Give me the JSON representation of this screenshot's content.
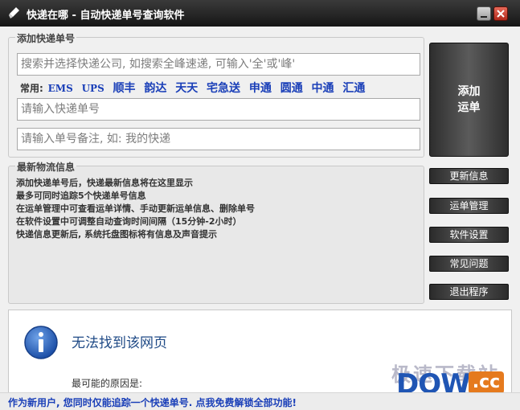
{
  "window": {
    "title": "快递在哪 - 自动快递单号查询软件"
  },
  "add_group": {
    "legend": "添加快递单号",
    "company_search_placeholder": "搜索并选择快递公司, 如搜索全峰速递, 可输入'全'或'峰'",
    "common_label": "常用:",
    "common_couriers": [
      "EMS",
      "UPS",
      "顺丰",
      "韵达",
      "天天",
      "宅急送",
      "申通",
      "圆通",
      "中通",
      "汇通"
    ],
    "tracking_placeholder": "请输入快递单号",
    "remark_placeholder": "请输入单号备注, 如: 我的快递"
  },
  "add_button": {
    "line1": "添加",
    "line2": "运单"
  },
  "info_group": {
    "legend": "最新物流信息",
    "lines": [
      "添加快递单号后，快递最新信息将在这里显示",
      "最多可同时追踪5个快递单号信息",
      "在运单管理中可查看运单详情、手动更新运单信息、删除单号",
      "在软件设置中可调整自动查询时间间隔（15分钟-2小时）",
      "快递信息更新后, 系统托盘图标将有信息及声音提示"
    ]
  },
  "side_buttons": {
    "update": "更新信息",
    "manage": "运单管理",
    "settings": "软件设置",
    "faq": "常见问题",
    "exit": "退出程序"
  },
  "browser_panel": {
    "error_title": "无法找到该网页",
    "reasons_label": "最可能的原因是:"
  },
  "watermark": {
    "top": "极速下载站",
    "down": "DOWN",
    "cc": ".cc"
  },
  "status_bar": {
    "text": "作为新用户, 您同时仅能追踪一个快递单号. 点我免费解锁全部功能!"
  },
  "colors": {
    "link_blue": "#1a3fb8",
    "titlebar": "#222222",
    "close_red": "#c83a2a"
  }
}
